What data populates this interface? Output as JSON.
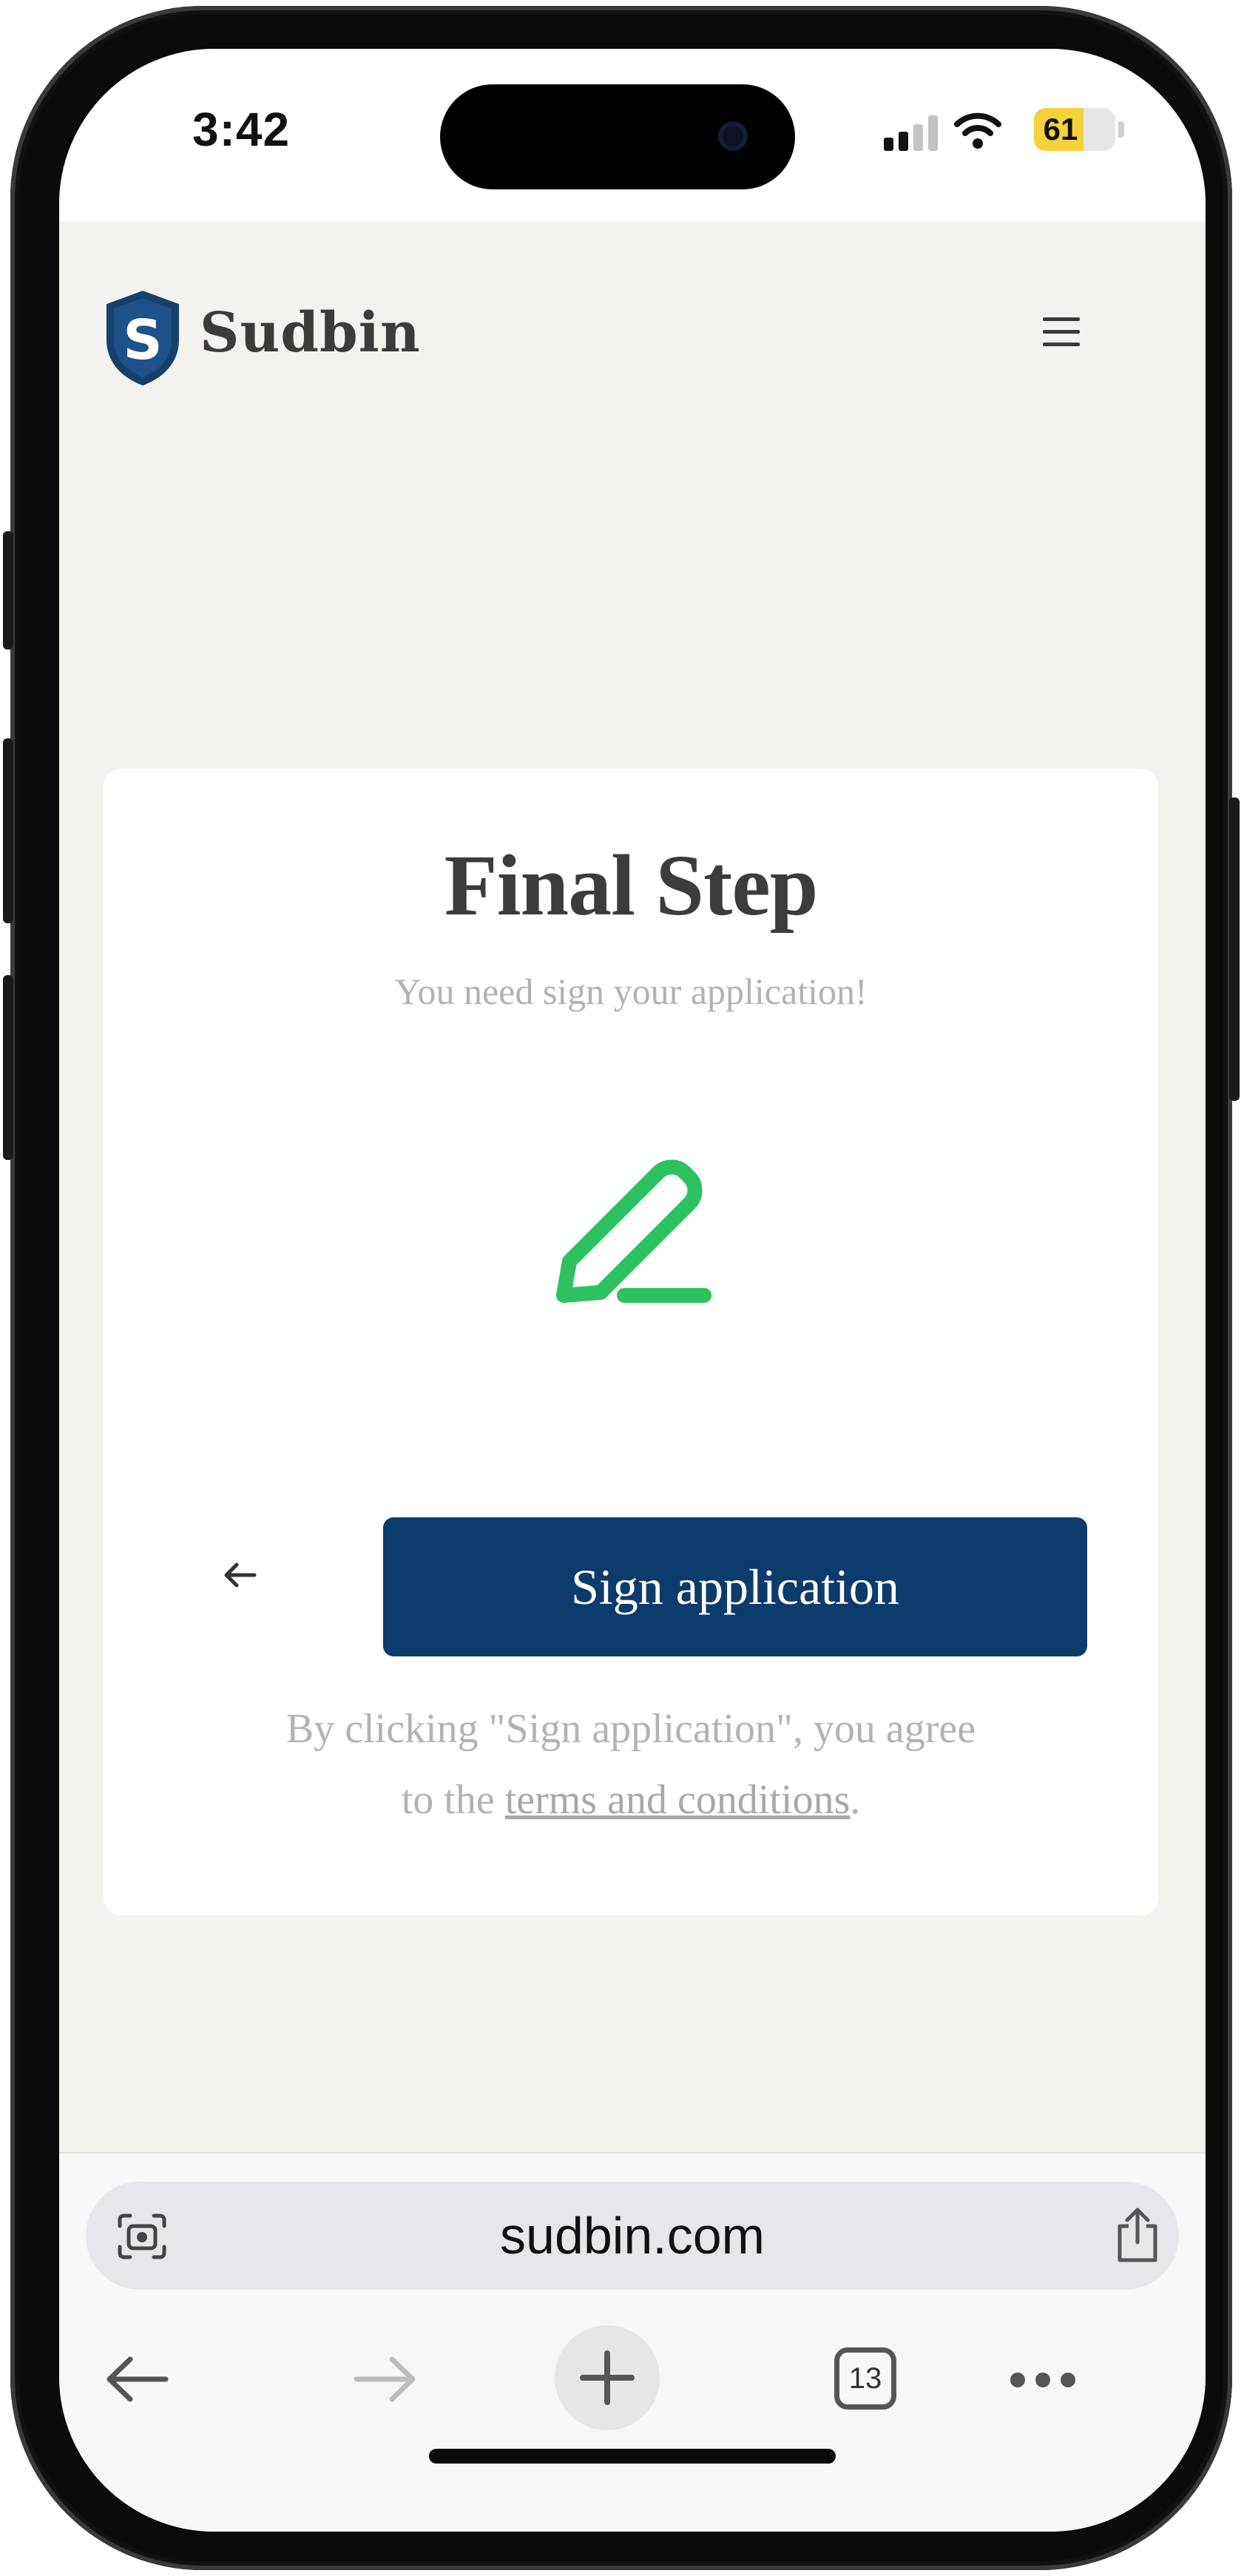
{
  "status_bar": {
    "time": "3:42",
    "battery_percent": "61",
    "battery_level": 0.61,
    "icons": [
      "cellular-signal-icon",
      "wifi-icon",
      "battery-icon"
    ]
  },
  "header": {
    "brand": "Sudbin",
    "logo_letter": "S",
    "logo_icon": "shield-logo-icon",
    "menu_icon": "hamburger-menu-icon"
  },
  "card": {
    "title": "Final Step",
    "subtitle": "You need sign your application!",
    "illustration_icon": "pencil-icon",
    "back_icon": "arrow-left-icon",
    "sign_button_label": "Sign application",
    "legal_prefix": "By clicking \"Sign application\", you agree",
    "legal_to_the": "to the ",
    "legal_link": "terms and conditions",
    "legal_suffix": "."
  },
  "browser": {
    "url": "sudbin.com",
    "open_tabs_count": "13",
    "icons": [
      "visual-lookup-icon",
      "share-icon",
      "back-icon",
      "forward-icon",
      "new-tab-plus-icon",
      "tabs-icon",
      "more-icon"
    ]
  },
  "colors": {
    "primary_button": "#0c3c6b",
    "accent_green": "#2ec15f",
    "page_background": "#f3f2ef",
    "battery": "#f5d13a"
  }
}
